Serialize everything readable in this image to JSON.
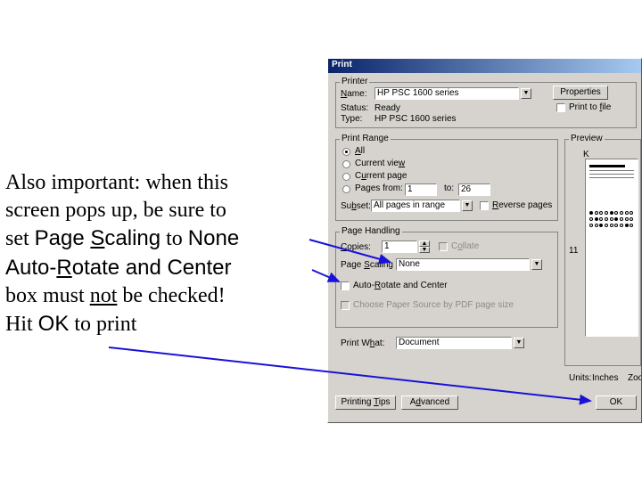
{
  "instructions": {
    "line1a": "Also important: when this",
    "line2a": "screen pops up, be sure to",
    "line3_set": "set ",
    "line3_pagescaling": "Page ",
    "line3_s": "S",
    "line3_caling": "caling",
    "line3_to": " to ",
    "line3_none": "None",
    "line4_auto": "Auto-",
    "line4_r": "R",
    "line4_otate": "otate and Center",
    "line5_boxmust": "box must ",
    "line5_not": "not",
    "line5_bechecked": " be checked!",
    "line6_hit": "Hit ",
    "line6_ok": "OK",
    "line6_toprint": " to print"
  },
  "dialog": {
    "title": "Print",
    "printer_group": "Printer",
    "name_label": "Name:",
    "name_value": "HP PSC 1600 series",
    "properties": "Properties",
    "status_label": "Status:",
    "status_value": "Ready",
    "type_label": "Type:",
    "type_value": "HP PSC 1600 series",
    "print_to_file": "Print to file",
    "print_range_group": "Print Range",
    "range_all": "All",
    "range_current_view": "Current view",
    "range_current_page": "Current page",
    "range_pages_from": "Pages from:",
    "range_from_value": "1",
    "range_to": "to:",
    "range_to_value": "26",
    "subset_label": "Subset:",
    "subset_value": "All pages in range",
    "reverse_pages": "Reverse pages",
    "page_handling_group": "Page Handling",
    "copies_label": "Copies:",
    "copies_value": "1",
    "collate": "Collate",
    "page_scaling_label": "Page Scaling",
    "page_scaling_value": "None",
    "auto_rotate": "Auto-Rotate and Center",
    "choose_paper": "Choose Paper Source by PDF page size",
    "print_what_label": "Print What:",
    "print_what_value": "Document",
    "printing_tips": "Printing Tips",
    "advanced": "Advanced",
    "preview_group": "Preview",
    "preview_dim": "11",
    "units_label": "Units:",
    "units_value": "Inches",
    "zoom_label": "Zoo",
    "ok": "OK"
  }
}
